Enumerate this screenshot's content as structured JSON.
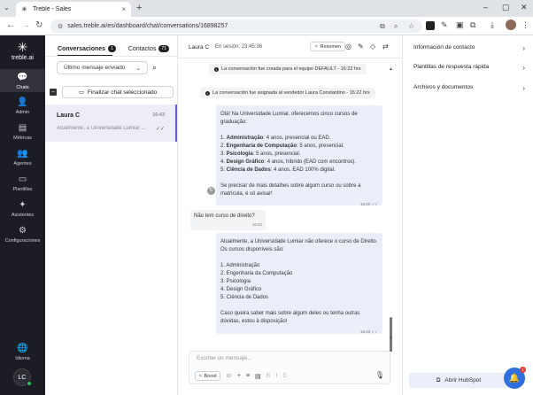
{
  "browser": {
    "tab_title": "Treble - Sales",
    "url": "sales.treble.ai/es/dashboard/chat/conversations/16898257"
  },
  "leftnav": {
    "brand": "treble.ai",
    "items": [
      {
        "label": "Chats",
        "icon": "chat-icon",
        "glyph": "💬"
      },
      {
        "label": "Admin",
        "icon": "admin-icon",
        "glyph": "👤"
      },
      {
        "label": "Métricas",
        "icon": "metrics-icon",
        "glyph": "▤"
      },
      {
        "label": "Agentes",
        "icon": "agents-icon",
        "glyph": "👥"
      },
      {
        "label": "Plantillas",
        "icon": "templates-icon",
        "glyph": "▭"
      },
      {
        "label": "Asistentes",
        "icon": "assistants-icon",
        "glyph": "✦"
      },
      {
        "label": "Configuraciones",
        "icon": "settings-icon",
        "glyph": "⚙"
      },
      {
        "label": "Idioma",
        "icon": "globe-icon",
        "glyph": "🌐"
      }
    ],
    "avatar_initials": "LC"
  },
  "convlist": {
    "tab_conversations": "Conversaciones",
    "tab_conversations_count": "1",
    "tab_contacts": "Contactos",
    "tab_contacts_count": "71",
    "filter_value": "Último mensaje enviado",
    "bulk_finish_label": "Finalizar chat seleccionado",
    "items": [
      {
        "name": "Laura C",
        "time": "16:43",
        "preview": "Atualmente, a Universidade Lumiar ..."
      }
    ]
  },
  "chat": {
    "contact_name": "Laura C",
    "session_text": "En sesión: 23:45:36",
    "resumen_label": "Resumen",
    "system_messages": [
      "La conversación fue creada para el equipo DEFAULT - 16:22 hrs",
      "La conversación fue asignada al vendedor Laura Constantino - 16:22 hrs"
    ],
    "msg1": {
      "intro": "Olá! Na Universidade Lumiar, oferecemos cinco cursos de graduação:",
      "items": [
        {
          "bold": "Administração",
          "rest": ": 4 anos, presencial ou EAD."
        },
        {
          "bold": "Engenharia de Computação",
          "rest": ": 5 anos, presencial."
        },
        {
          "bold": "Psicologia",
          "rest": ": 5 anos, presencial."
        },
        {
          "bold": "Design Gráfico",
          "rest": ": 4 anos, híbrido (EAD com encontros)."
        },
        {
          "bold": "Ciência de Dados",
          "rest": ": 4 anos, EAD 100% digital."
        }
      ],
      "outro": "Se precisar de mais detalhes sobre algum curso ou sobre a matrícula, é só avisar!",
      "time": "16:25"
    },
    "msg2": {
      "text": "Não tem curso de direito?",
      "time": "16:42"
    },
    "msg3": {
      "intro": "Atualmente, a Universidade Lumiar não oferece o curso de Direito. Os cursos disponíveis são:",
      "items": [
        "1. Administração",
        "2. Engenharia da Computação",
        "3. Psicologia",
        "4. Design Gráfico",
        "5. Ciência de Dados"
      ],
      "outro": "Caso queira saber mais sobre algum deles ou tenha outras dúvidas, estou à disposição!",
      "time": "16:43"
    },
    "composer_placeholder": "Escribe un mensaje...",
    "boost_label": "Boost"
  },
  "rightpanel": {
    "items": [
      "Información de contacto",
      "Plantillas de respuesta rápida",
      "Archivos y documentos"
    ],
    "hubspot_label": "Abrir HubSpot",
    "fab_badge": "1"
  }
}
